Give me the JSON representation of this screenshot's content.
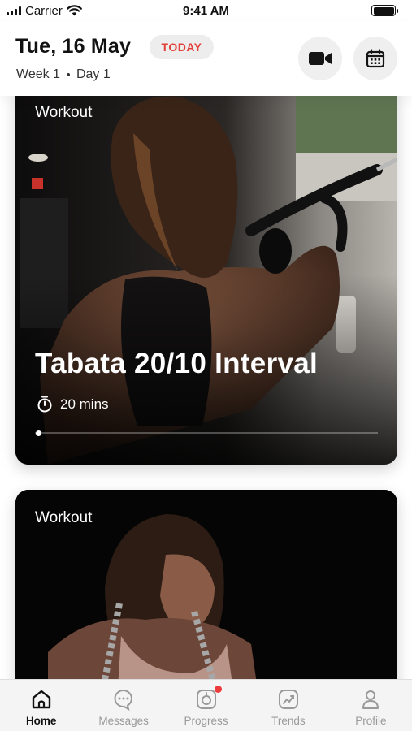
{
  "status_bar": {
    "carrier": "Carrier",
    "time": "9:41 AM"
  },
  "header": {
    "date": "Tue, 16 May",
    "today_badge": "TODAY",
    "week": "Week 1",
    "day": "Day 1",
    "video_button_icon": "video-camera-icon",
    "calendar_button_icon": "calendar-icon"
  },
  "cards": [
    {
      "tag": "Workout",
      "title": "Tabata 20/10 Interval",
      "duration": "20 mins",
      "progress": 0.01
    },
    {
      "tag": "Workout"
    }
  ],
  "tabs": [
    {
      "label": "Home",
      "icon": "home-icon",
      "active": true
    },
    {
      "label": "Messages",
      "icon": "chat-bubble-icon",
      "active": false
    },
    {
      "label": "Progress",
      "icon": "progress-icon",
      "active": false,
      "notification": true
    },
    {
      "label": "Trends",
      "icon": "trend-chart-icon",
      "active": false
    },
    {
      "label": "Profile",
      "icon": "profile-icon",
      "active": false
    }
  ],
  "colors": {
    "accent": "#e3403a",
    "notification": "#ee3b3b",
    "inactive_tab": "#9a9a9a"
  }
}
